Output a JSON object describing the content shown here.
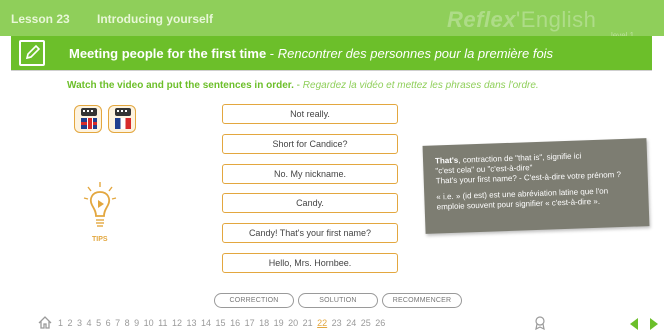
{
  "header": {
    "lesson": "Lesson 23",
    "section": "Introducing yourself",
    "brand_main": "Reflex",
    "brand_accent": "'English",
    "brand_level": "level 1"
  },
  "title": {
    "en": "Meeting people for the first time",
    "separator": " - ",
    "fr": "Rencontrer des personnes pour la première fois"
  },
  "instruction": {
    "en": "Watch the video and put the sentences in order.",
    "separator": " - ",
    "fr": "Regardez la vidéo et mettez les phrases dans l'ordre."
  },
  "tips_label": "TIPS",
  "sentences": [
    "Not really.",
    "Short for Candice?",
    "No. My nickname.",
    "Candy.",
    "Candy! That's your first name?",
    "Hello, Mrs. Hornbee."
  ],
  "tooltip": {
    "term": "That's",
    "line1": ", contraction de \"that is\", signifie ici",
    "line2": "\"c'est cela\" ou \"c'est-à-dire\"",
    "line3": "That's your first name? - C'est-à-dire votre prénom ?",
    "line4": "« i.e. » (id est) est une abréviation latine que l'on emploie souvent pour signifier « c'est-à-dire »."
  },
  "controls": {
    "correction": "CORRECTION",
    "solution": "SOLUTION",
    "restart": "RECOMMENCER"
  },
  "pages": [
    "1",
    "2",
    "3",
    "4",
    "5",
    "6",
    "7",
    "8",
    "9",
    "10",
    "11",
    "12",
    "13",
    "14",
    "15",
    "16",
    "17",
    "18",
    "19",
    "20",
    "21",
    "22",
    "23",
    "24",
    "25",
    "26"
  ],
  "current_page": "22",
  "colors": {
    "green_dark": "#6cbf2a",
    "green_light": "#8fcf5a",
    "orange": "#e3a73f",
    "tooltip_bg": "#7d7d72"
  }
}
